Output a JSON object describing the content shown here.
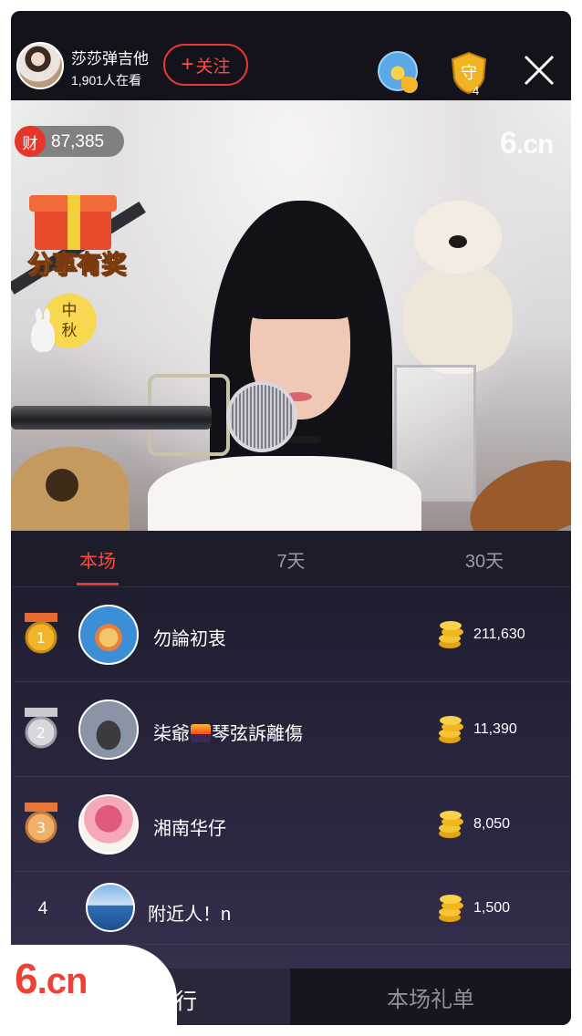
{
  "header": {
    "host_name": "莎莎弹吉他",
    "viewers": "1,901人在看",
    "follow_label": "关注",
    "follow_plus": "+",
    "guard_char": "守",
    "guard_count": "4"
  },
  "video": {
    "wealth_icon": "财",
    "wealth_value": "87,385",
    "watermark_six": "6",
    "watermark_cn": ".cn",
    "share_prize": "分享有奖",
    "midautumn_1": "中",
    "midautumn_2": "秋"
  },
  "tabs": [
    {
      "label": "本场",
      "active": true
    },
    {
      "label": "7天",
      "active": false
    },
    {
      "label": "30天",
      "active": false
    }
  ],
  "ranking": [
    {
      "rank": "1",
      "name": "勿論初衷",
      "amount": "211,630",
      "medal": "gold"
    },
    {
      "rank": "2",
      "name_a": "柒爺",
      "name_b": "琴弦訴離傷",
      "amount": "11,390",
      "medal": "silver"
    },
    {
      "rank": "3",
      "name": "湘南华仔",
      "amount": "8,050",
      "medal": "bronze"
    },
    {
      "rank": "4",
      "name": "附近人！n",
      "amount": "1,500",
      "medal": "none"
    }
  ],
  "bottom": {
    "logo_six": "6",
    "logo_cn": ".cn",
    "left_label": "排行",
    "right_label": "本场礼单"
  },
  "colors": {
    "accent": "#e53935",
    "list_bg": "#1f1e30",
    "header_bg": "#14131c"
  },
  "icons": [
    "close-icon",
    "guard-shield-icon",
    "coin-stack-icon",
    "medal-icon",
    "gift-icon"
  ]
}
